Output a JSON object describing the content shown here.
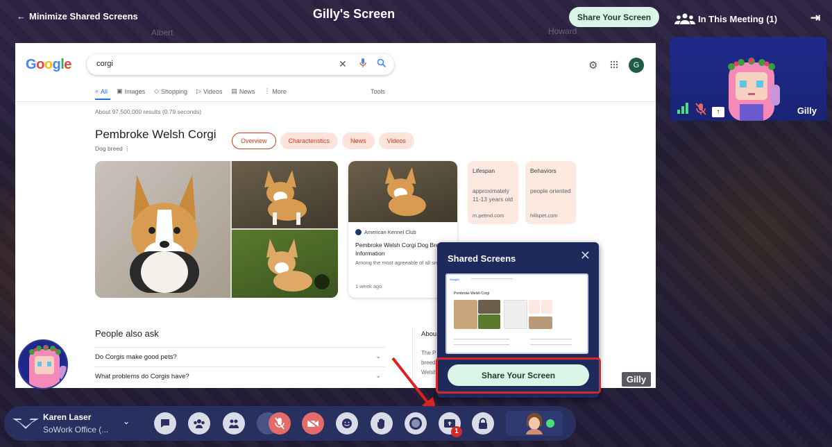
{
  "header": {
    "minimize_label": "Minimize Shared Screens",
    "screen_title": "Gilly's Screen",
    "share_button": "Share Your Screen",
    "in_meeting_label": "In This Meeting (1)"
  },
  "background_names": [
    "Albert",
    "Howard"
  ],
  "participant": {
    "name": "Gilly"
  },
  "google": {
    "logo_text": "Google",
    "query": "corgi",
    "tabs": [
      "All",
      "Images",
      "Shopping",
      "Videos",
      "News",
      "More"
    ],
    "active_tab": "All",
    "tools": "Tools",
    "account_initial": "G",
    "results_count": "About 97,500,000 results (0.79 seconds)",
    "kp_title": "Pembroke Welsh Corgi",
    "kp_subtitle": "Dog breed",
    "chips": [
      "Overview",
      "Characteristics",
      "News",
      "Videos"
    ],
    "card": {
      "source": "American Kennel Club",
      "title": "Pembroke Welsh Corgi Dog Breed Information",
      "snippet": "Among the most agreeable of all sm",
      "date": "1 week ago"
    },
    "facts": [
      {
        "label": "Lifespan",
        "value": "approximately 11-13 years old",
        "source": "m.petmd.com"
      },
      {
        "label": "Behaviors",
        "value": "people oriented",
        "source": "hillspet.com"
      }
    ],
    "paa_title": "People also ask",
    "paa_items": [
      "Do Corgis make good pets?",
      "What problems do Corgis have?"
    ],
    "about_label": "Abou",
    "about_text": "The P breed Welsh"
  },
  "popover": {
    "title": "Shared Screens",
    "share_button": "Share Your Screen",
    "thumb_title": "Pembroke Welsh Corgi"
  },
  "screen_label": "Gilly",
  "user": {
    "name": "Karen Laser",
    "office": "SoWork Office (..."
  },
  "toolbar": {
    "buttons": [
      "chat",
      "people",
      "contacts",
      "mic-muted",
      "camera-off",
      "emoji",
      "raise-hand",
      "record",
      "share-screen",
      "lock"
    ],
    "share_badge": "1"
  },
  "colors": {
    "accent_green": "#d9f5e6",
    "bar_bg": "#27305e",
    "alert_red": "#d62828"
  }
}
